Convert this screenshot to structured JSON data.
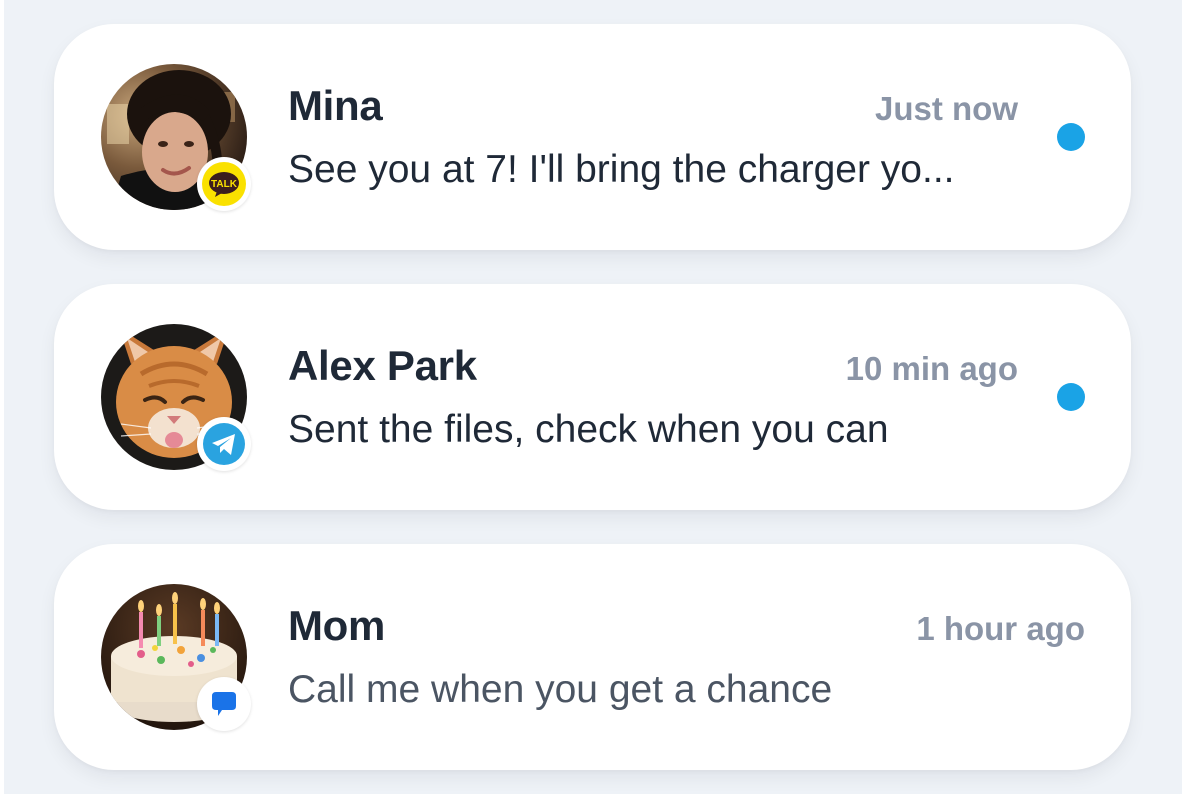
{
  "conversations": [
    {
      "name": "Mina",
      "time": "Just now",
      "preview": "See you at 7! I'll bring the charger yo...",
      "unread": true,
      "app_icon": "kakaotalk-icon",
      "badge_text": "TALK",
      "badge_color": "#FAE100",
      "avatar": "woman-selfie-photo"
    },
    {
      "name": "Alex Park",
      "time": "10 min ago",
      "preview": "Sent the files, check when you can",
      "unread": true,
      "app_icon": "telegram-icon",
      "badge_color": "#2AA3E0",
      "avatar": "orange-cat-photo"
    },
    {
      "name": "Mom",
      "time": "1 hour ago",
      "preview": "Call me when you get a chance",
      "unread": false,
      "app_icon": "google-messages-icon",
      "badge_color": "#1A73E8",
      "avatar": "birthday-cake-photo"
    }
  ],
  "colors": {
    "page_background": "#EEF2F7",
    "card_background": "#FFFFFF",
    "name_text": "#1F2937",
    "time_text": "#8A94A6",
    "unread_dot": "#1AA3E6"
  }
}
